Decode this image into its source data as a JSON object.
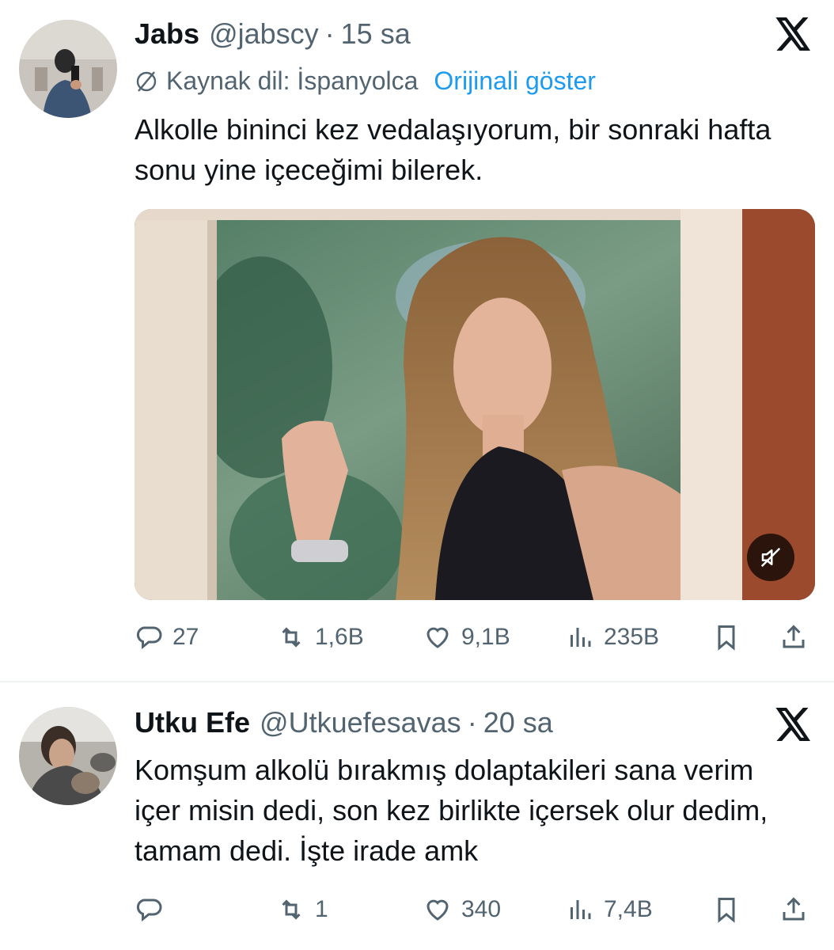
{
  "tweets": [
    {
      "name": "Jabs",
      "handle": "@jabscy",
      "separator": "·",
      "time": "15 sa",
      "translation": {
        "source_label": "Kaynak dil: İspanyolca",
        "show_original": "Orijinali göster"
      },
      "text": "Alkolle bininci kez vedalaşıyorum, bir sonraki hafta sonu yine içeceğimi bilerek.",
      "media": {
        "type": "video",
        "muted_icon": "speaker-muted-icon"
      },
      "stats": {
        "replies": "27",
        "reposts": "1,6B",
        "likes": "9,1B",
        "views": "235B"
      }
    },
    {
      "name": "Utku Efe",
      "handle": "@Utkuefesavas",
      "separator": "·",
      "time": "20 sa",
      "text": "Komşum alkolü bırakmış dolaptakileri sana verim içer misin dedi, son kez birlikte içersek olur dedim, tamam dedi. İşte irade amk",
      "stats": {
        "replies": "",
        "reposts": "1",
        "likes": "340",
        "views": "7,4B"
      }
    }
  ],
  "colors": {
    "text": "#0f1419",
    "secondary": "#536471",
    "link": "#1d9bf0",
    "divider": "#eff3f4"
  }
}
